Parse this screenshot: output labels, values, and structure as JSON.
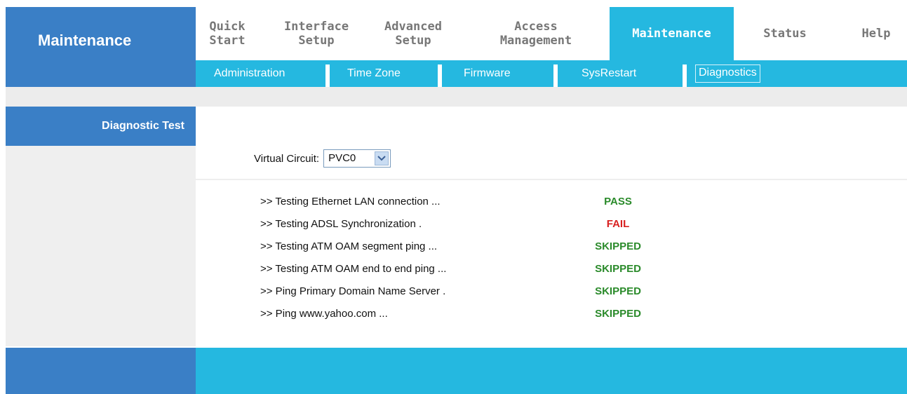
{
  "brand": {
    "title": "Maintenance"
  },
  "tabs": [
    {
      "label": "Quick\nStart"
    },
    {
      "label": "Interface\nSetup"
    },
    {
      "label": "Advanced\nSetup"
    },
    {
      "label": "Access\nManagement"
    },
    {
      "label": "Maintenance",
      "active": true
    },
    {
      "label": "Status"
    },
    {
      "label": "Help"
    }
  ],
  "subtabs": [
    {
      "label": "Administration"
    },
    {
      "label": "Time Zone"
    },
    {
      "label": "Firmware"
    },
    {
      "label": "SysRestart"
    },
    {
      "label": "Diagnostics",
      "active": true
    }
  ],
  "sidebar": {
    "heading": "Diagnostic Test"
  },
  "virtual_circuit": {
    "label": "Virtual Circuit:",
    "selected": "PVC0"
  },
  "tests": [
    {
      "label": ">> Testing Ethernet LAN connection ...",
      "status": "PASS"
    },
    {
      "label": ">> Testing ADSL Synchronization .",
      "status": "FAIL"
    },
    {
      "label": ">> Testing ATM OAM segment ping ...",
      "status": "SKIPPED"
    },
    {
      "label": ">> Testing ATM OAM end to end ping ...",
      "status": "SKIPPED"
    },
    {
      "label": ">> Ping Primary Domain Name Server .",
      "status": "SKIPPED"
    },
    {
      "label": ">> Ping www.yahoo.com ...",
      "status": "SKIPPED"
    }
  ],
  "colors": {
    "accent": "#25b8e0",
    "brand_blue": "#3a7fc6",
    "pass": "#2a8a2a",
    "fail": "#d82020"
  }
}
